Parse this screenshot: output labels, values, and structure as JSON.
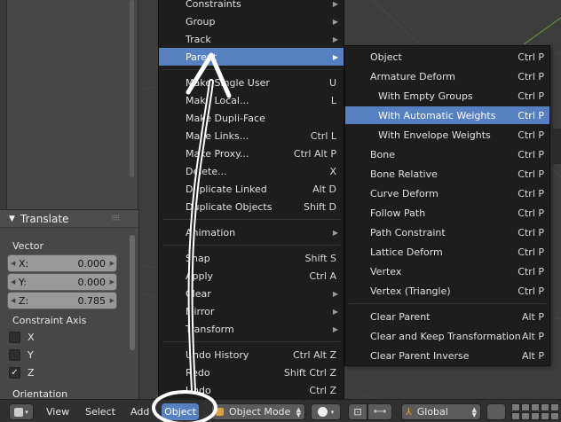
{
  "operator_panel": {
    "title": "Translate",
    "vector_label": "Vector",
    "vector": [
      {
        "axis": "X:",
        "value": "0.000"
      },
      {
        "axis": "Y:",
        "value": "0.000"
      },
      {
        "axis": "Z:",
        "value": "0.785"
      }
    ],
    "constraint_label": "Constraint Axis",
    "constraints": [
      {
        "label": "X",
        "checked": false,
        "mark": ""
      },
      {
        "label": "Y",
        "checked": false,
        "mark": ""
      },
      {
        "label": "Z",
        "checked": true,
        "mark": "✓"
      }
    ],
    "orientation_label": "Orientation"
  },
  "object_menu": {
    "items": [
      {
        "label": "Constraints",
        "shortcut": "",
        "submenu": true
      },
      {
        "label": "Group",
        "shortcut": "",
        "submenu": true
      },
      {
        "label": "Track",
        "shortcut": "",
        "submenu": true
      },
      {
        "label": "Parent",
        "shortcut": "",
        "submenu": true,
        "highlighted": true
      },
      {
        "label": "Make Single User",
        "shortcut": "U",
        "submenu": false
      },
      {
        "label": "Make Local...",
        "shortcut": "L",
        "submenu": false
      },
      {
        "label": "Make Dupli-Face",
        "shortcut": "",
        "submenu": false
      },
      {
        "label": "Make Links...",
        "shortcut": "Ctrl L",
        "submenu": false
      },
      {
        "label": "Make Proxy...",
        "shortcut": "Ctrl Alt P",
        "submenu": false
      },
      {
        "label": "Delete...",
        "shortcut": "X",
        "submenu": false
      },
      {
        "label": "Duplicate Linked",
        "shortcut": "Alt D",
        "submenu": false
      },
      {
        "label": "Duplicate Objects",
        "shortcut": "Shift D",
        "submenu": false
      },
      {
        "label": "Animation",
        "shortcut": "",
        "submenu": true
      },
      {
        "label": "Snap",
        "shortcut": "Shift S",
        "submenu": false
      },
      {
        "label": "Apply",
        "shortcut": "Ctrl A",
        "submenu": false
      },
      {
        "label": "Clear",
        "shortcut": "",
        "submenu": true
      },
      {
        "label": "Mirror",
        "shortcut": "",
        "submenu": true
      },
      {
        "label": "Transform",
        "shortcut": "",
        "submenu": true
      },
      {
        "label": "Undo History",
        "shortcut": "Ctrl Alt Z",
        "submenu": false
      },
      {
        "label": "Redo",
        "shortcut": "Shift Ctrl Z",
        "submenu": false
      },
      {
        "label": "Undo",
        "shortcut": "Ctrl Z",
        "submenu": false
      }
    ]
  },
  "parent_submenu": {
    "items": [
      {
        "label": "Object",
        "shortcut": "Ctrl P"
      },
      {
        "label": "Armature Deform",
        "shortcut": "Ctrl P"
      },
      {
        "label": "With Empty Groups",
        "shortcut": "Ctrl P",
        "indent": true
      },
      {
        "label": "With Automatic Weights",
        "shortcut": "Ctrl P",
        "indent": true,
        "highlighted": true
      },
      {
        "label": "With Envelope Weights",
        "shortcut": "Ctrl P",
        "indent": true
      },
      {
        "label": "Bone",
        "shortcut": "Ctrl P"
      },
      {
        "label": "Bone Relative",
        "shortcut": "Ctrl P"
      },
      {
        "label": "Curve Deform",
        "shortcut": "Ctrl P"
      },
      {
        "label": "Follow Path",
        "shortcut": "Ctrl P"
      },
      {
        "label": "Path Constraint",
        "shortcut": "Ctrl P"
      },
      {
        "label": "Lattice Deform",
        "shortcut": "Ctrl P"
      },
      {
        "label": "Vertex",
        "shortcut": "Ctrl P"
      },
      {
        "label": "Vertex (Triangle)",
        "shortcut": "Ctrl P"
      },
      {
        "label": "Clear Parent",
        "shortcut": "Alt P"
      },
      {
        "label": "Clear and Keep Transformation",
        "shortcut": "Alt P"
      },
      {
        "label": "Clear Parent Inverse",
        "shortcut": "Alt P"
      }
    ]
  },
  "header": {
    "menus": [
      "View",
      "Select",
      "Add",
      "Object"
    ],
    "mode": "Object Mode",
    "orientation": "Global",
    "accent_color": "#5680c2"
  }
}
